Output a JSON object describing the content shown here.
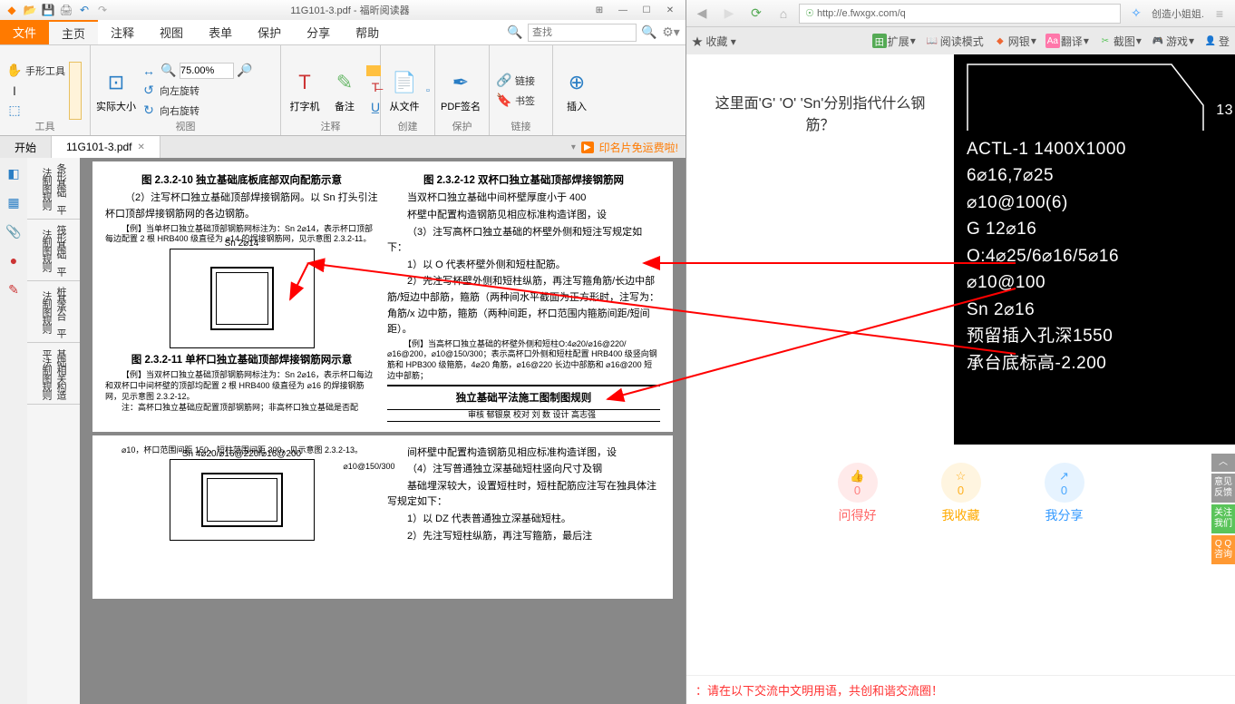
{
  "pdf": {
    "titlebar": {
      "title": "11G101-3.pdf - 福昕阅读器"
    },
    "tabs": {
      "file": "文件",
      "items": [
        "主页",
        "注释",
        "视图",
        "表单",
        "保护",
        "分享",
        "帮助"
      ],
      "active": 0,
      "search_ph": "查找"
    },
    "ribbon": {
      "tools": {
        "label": "工具",
        "hand": "手形工具"
      },
      "view": {
        "label": "视图",
        "actual": "实际大小",
        "zoom": "75.00%",
        "rotL": "向左旋转",
        "rotR": "向右旋转"
      },
      "annot": {
        "label": "注释",
        "type": "打字机",
        "note": "备注"
      },
      "create": {
        "label": "创建",
        "fromfile": "从文件"
      },
      "protect": {
        "label": "保护",
        "sign": "PDF签名"
      },
      "link": {
        "label": "链接",
        "link": "链接",
        "bookmark": "书签"
      },
      "insert": {
        "label": "",
        "insert": "插入"
      }
    },
    "doctabs": {
      "tabs": [
        "开始",
        "11G101-3.pdf"
      ],
      "active": 1,
      "promo": "印名片免运费啦!"
    },
    "nav": [
      "条形基础 平法制图规则",
      "筏形基础 平法制图规则",
      "桩基承台 平法制图规则",
      "基础相关构造 平法制图规则"
    ],
    "doc": {
      "fig10": "图 2.3.2-10  独立基础底板底部双向配筋示意",
      "p2": "（2）注写杯口独立基础顶部焊接钢筋网。以 Sn 打头引注杯口顶部焊接钢筋网的各边钢筋。",
      "ex1": "【例】当单杯口独立基础顶部钢筋网标注为：Sn 2⌀14，表示杯口顶部每边配置 2 根 HRB400 级直径为 ⌀14 的焊接钢筋网，见示意图 2.3.2-11。",
      "snlabel": "Sn 2⌀14",
      "fig11": "图 2.3.2-11  单杯口独立基础顶部焊接钢筋网示意",
      "ex2": "【例】当双杯口独立基础顶部钢筋网标注为：Sn 2⌀16，表示杯口每边和双杯口中间杯壁的顶部均配置 2 根 HRB400 级直径为 ⌀16 的焊接钢筋网，见示意图 2.3.2-12。",
      "note1": "注：高杯口独立基础应配置顶部钢筋网；非高杯口独立基础是否配",
      "fig12": "图 2.3.2-12  双杯口独立基础顶部焊接钢筋网",
      "r1": "当双杯口独立基础中间杯壁厚度小于 400",
      "r2": "杯壁中配置构造钢筋见相应标准构造详图，设",
      "r3": "（3）注写高杯口独立基础的杯壁外侧和短注写规定如下：",
      "r4": "1）以 O 代表杯壁外侧和短柱配筋。",
      "r5": "2）先注写杯壁外侧和短柱纵筋，再注写箍角筋/长边中部筋/短边中部筋，箍筋（两种间水平截面为正方形时，注写为：角筋/x 边中筋，箍筋（两种间距，杯口范围内箍筋间距/短间距）。",
      "r_ex": "【例】当高杯口独立基础的杯壁外侧和短柱O:4⌀20/⌀16@220/⌀16@200，⌀10@150/300；表示高杯口外侧和短柱配置 HRB400 级竖向钢筋和 HPB300 级箍筋，4⌀20 角筋，⌀16@220 长边中部筋和 ⌀16@200 短边中部筋；",
      "rule_title": "独立基础平法施工图制图规则",
      "rule_row": "审核 郁银泉   校对 刘    数    设计 高志强",
      "p10": "⌀10，杯口范围间距 150，短柱范围间距 300，见示意图 2.3.2-13。",
      "sn2": "Sn 4⌀20/⌀16@220/⌀16@200",
      "sn3": "⌀10@150/300",
      "rb1": "间杯壁中配置构造钢筋见相应标准构造详图，设",
      "rb2": "（4）注写普通独立深基础短柱竖向尺寸及钢",
      "rb3": "基础埋深较大，设置短柱时，短柱配筋应注写在独具体注写规定如下：",
      "rb4": "1）以 DZ 代表普通独立深基础短柱。",
      "rb5": "2）先注写短柱纵筋，再注写箍筋，最后注"
    }
  },
  "browser": {
    "url": "http://e.fwxgx.com/q",
    "tab_right": "创造小姐姐.",
    "fav": "收藏",
    "ext": {
      "expand": "扩展",
      "read": "阅读模式",
      "bank": "网银",
      "trans": "翻译",
      "shot": "截图",
      "game": "游戏",
      "login": "登"
    },
    "question": "这里面'G' 'O' 'Sn'分别指代什么钢筋？",
    "cad": [
      "ACTL-1 1400X1000",
      "6⌀16,7⌀25",
      "⌀10@100(6)",
      "G 12⌀16",
      "O:4⌀25/6⌀16/5⌀16",
      "⌀10@100",
      "Sn 2⌀16",
      "预留插入孔深1550",
      "承台底标高-2.200"
    ],
    "cad_dim": "13",
    "actions": {
      "good": {
        "label": "问得好",
        "count": "0",
        "icon": "👍"
      },
      "fav": {
        "label": "我收藏",
        "count": "0",
        "icon": "☆"
      },
      "share": {
        "label": "我分享",
        "count": "0",
        "icon": "↗"
      }
    },
    "footer": "：请在以下交流中文明用语，共创和谐交流圈！",
    "side": [
      "意见反馈",
      "关注我们",
      "Q Q咨询"
    ]
  }
}
